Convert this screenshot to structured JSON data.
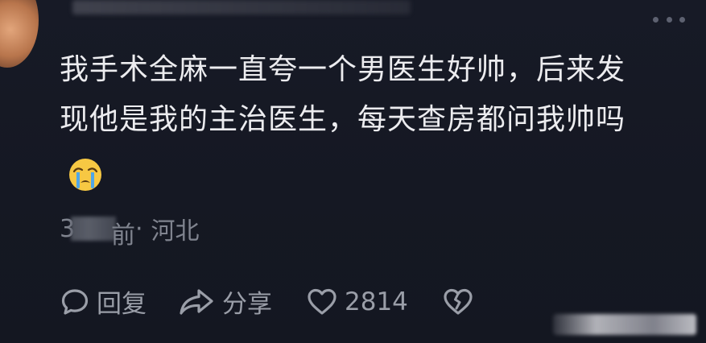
{
  "comment": {
    "line1": "我手术全麻一直夸一个男医生好帅，后来发",
    "line2": "现他是我的主治医生，每天查房都问我帅吗",
    "emoji": "crying-face"
  },
  "meta": {
    "time_prefix": "3",
    "time_suffix": "前",
    "separator": "·",
    "location": "河北"
  },
  "actions": {
    "reply_label": "回复",
    "share_label": "分享",
    "like_count": "2814"
  },
  "icons": {
    "more": "more-dots-icon",
    "reply": "comment-bubble-icon",
    "share": "share-arrow-icon",
    "like": "heart-outline-icon",
    "dislike": "broken-heart-icon"
  },
  "colors": {
    "background": "#161823",
    "text": "#ececef",
    "muted": "#80848f",
    "action": "#9a9ea8"
  }
}
